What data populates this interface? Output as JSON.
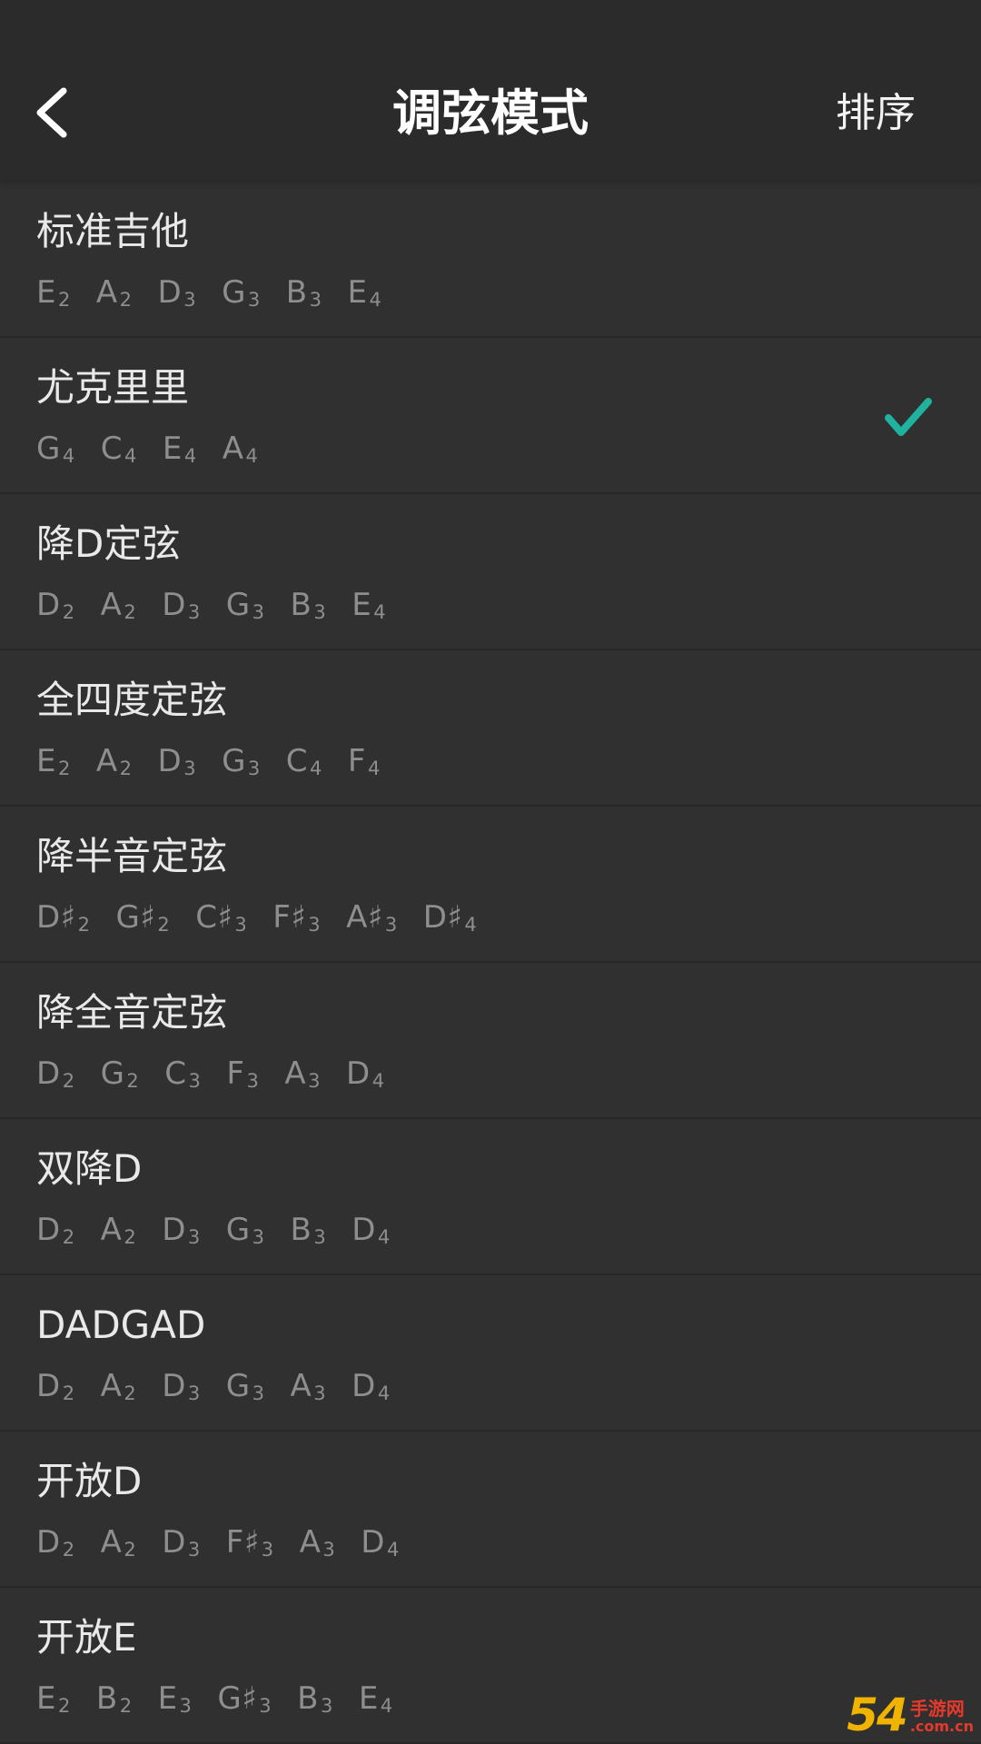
{
  "header": {
    "title": "调弦模式",
    "sort_label": "排序",
    "back_icon": "chevron-left-icon"
  },
  "colors": {
    "check_accent": "#1fb39f",
    "background": "#2f2f30"
  },
  "tunings": [
    {
      "name": "标准吉他",
      "selected": false,
      "notes": [
        {
          "n": "E",
          "o": "2"
        },
        {
          "n": "A",
          "o": "2"
        },
        {
          "n": "D",
          "o": "3"
        },
        {
          "n": "G",
          "o": "3"
        },
        {
          "n": "B",
          "o": "3"
        },
        {
          "n": "E",
          "o": "4"
        }
      ]
    },
    {
      "name": "尤克里里",
      "selected": true,
      "notes": [
        {
          "n": "G",
          "o": "4"
        },
        {
          "n": "C",
          "o": "4"
        },
        {
          "n": "E",
          "o": "4"
        },
        {
          "n": "A",
          "o": "4"
        }
      ]
    },
    {
      "name": "降D定弦",
      "selected": false,
      "notes": [
        {
          "n": "D",
          "o": "2"
        },
        {
          "n": "A",
          "o": "2"
        },
        {
          "n": "D",
          "o": "3"
        },
        {
          "n": "G",
          "o": "3"
        },
        {
          "n": "B",
          "o": "3"
        },
        {
          "n": "E",
          "o": "4"
        }
      ]
    },
    {
      "name": "全四度定弦",
      "selected": false,
      "notes": [
        {
          "n": "E",
          "o": "2"
        },
        {
          "n": "A",
          "o": "2"
        },
        {
          "n": "D",
          "o": "3"
        },
        {
          "n": "G",
          "o": "3"
        },
        {
          "n": "C",
          "o": "4"
        },
        {
          "n": "F",
          "o": "4"
        }
      ]
    },
    {
      "name": "降半音定弦",
      "selected": false,
      "notes": [
        {
          "n": "D♯",
          "o": "2"
        },
        {
          "n": "G♯",
          "o": "2"
        },
        {
          "n": "C♯",
          "o": "3"
        },
        {
          "n": "F♯",
          "o": "3"
        },
        {
          "n": "A♯",
          "o": "3"
        },
        {
          "n": "D♯",
          "o": "4"
        }
      ]
    },
    {
      "name": "降全音定弦",
      "selected": false,
      "notes": [
        {
          "n": "D",
          "o": "2"
        },
        {
          "n": "G",
          "o": "2"
        },
        {
          "n": "C",
          "o": "3"
        },
        {
          "n": "F",
          "o": "3"
        },
        {
          "n": "A",
          "o": "3"
        },
        {
          "n": "D",
          "o": "4"
        }
      ]
    },
    {
      "name": "双降D",
      "selected": false,
      "notes": [
        {
          "n": "D",
          "o": "2"
        },
        {
          "n": "A",
          "o": "2"
        },
        {
          "n": "D",
          "o": "3"
        },
        {
          "n": "G",
          "o": "3"
        },
        {
          "n": "B",
          "o": "3"
        },
        {
          "n": "D",
          "o": "4"
        }
      ]
    },
    {
      "name": "DADGAD",
      "selected": false,
      "notes": [
        {
          "n": "D",
          "o": "2"
        },
        {
          "n": "A",
          "o": "2"
        },
        {
          "n": "D",
          "o": "3"
        },
        {
          "n": "G",
          "o": "3"
        },
        {
          "n": "A",
          "o": "3"
        },
        {
          "n": "D",
          "o": "4"
        }
      ]
    },
    {
      "name": "开放D",
      "selected": false,
      "notes": [
        {
          "n": "D",
          "o": "2"
        },
        {
          "n": "A",
          "o": "2"
        },
        {
          "n": "D",
          "o": "3"
        },
        {
          "n": "F♯",
          "o": "3"
        },
        {
          "n": "A",
          "o": "3"
        },
        {
          "n": "D",
          "o": "4"
        }
      ]
    },
    {
      "name": "开放E",
      "selected": false,
      "notes": [
        {
          "n": "E",
          "o": "2"
        },
        {
          "n": "B",
          "o": "2"
        },
        {
          "n": "E",
          "o": "3"
        },
        {
          "n": "G♯",
          "o": "3"
        },
        {
          "n": "B",
          "o": "3"
        },
        {
          "n": "E",
          "o": "4"
        }
      ]
    }
  ],
  "watermark": {
    "logo": "54",
    "top": "手游网",
    "bottom": ".com.cn"
  }
}
